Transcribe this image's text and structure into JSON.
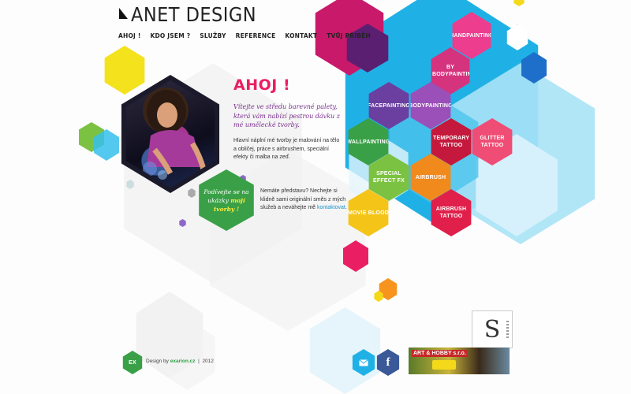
{
  "site": {
    "logo_text": "ANET DESIGN"
  },
  "nav": {
    "items": [
      "AHOJ !",
      "KDO JSEM ?",
      "SLUŽBY",
      "REFERENCE",
      "KONTAKT",
      "TVŮJ PŘÍBĚH"
    ]
  },
  "hero": {
    "greeting": "AHOJ !",
    "intro": "Vítejte ve středu barevné palety, která vám nabízí pestrou dávku z mé umělecké tvorby.",
    "description": "Hlavní náplní mé tvorby je malování na tělo a obličej, práce s airbrushem, speciální efekty či malba na zeď.",
    "cta_prefix": "Nemáte představu? Nechejte si klidně sami originální směs z mých služeb a neváhejte mě ",
    "cta_link": "kontaktovat",
    "cta_suffix": "."
  },
  "green_hex": {
    "line1": "Podívejte se na",
    "line2": "ukázky",
    "bold": "mojí",
    "line3": "tvorby !"
  },
  "services": [
    {
      "label": "HANDPAINTING",
      "color": "#ec3d8f"
    },
    {
      "label": "BY BODYPAINTING",
      "color": "#d6337e"
    },
    {
      "label": "FACEPAINTING",
      "color": "#6a3fa0"
    },
    {
      "label": "BODYPAINTING",
      "color": "#9b4fb8"
    },
    {
      "label": "WALLPAINTING",
      "color": "#3aa047"
    },
    {
      "label": "TEMPORARY TATTOO",
      "color": "#c4193c"
    },
    {
      "label": "GLITTER TATTOO",
      "color": "#ef4d75"
    },
    {
      "label": "SPECIAL EFFECT FX",
      "color": "#7cc242"
    },
    {
      "label": "AIRBRUSH",
      "color": "#f08a1c"
    },
    {
      "label": "MOVIE BLOOD",
      "color": "#f4c518"
    },
    {
      "label": "AIRBRUSH TATTOO",
      "color": "#e01f4a"
    }
  ],
  "footer": {
    "badge": "EX",
    "prefix": "Design by ",
    "link": "exarion.cz",
    "sep": "  |  ",
    "year": "2012",
    "email_icon": "mail-icon",
    "facebook_icon": "facebook-icon",
    "facebook_letter": "f",
    "partner1_letter": "S",
    "partner2_text": "ART & HOBBY s.r.o."
  },
  "colors": {
    "pink": "#ea1e63",
    "purple": "#7b2d8f",
    "cyan": "#1fb1e6",
    "green": "#3aa047",
    "yellow": "#f4d81a"
  }
}
